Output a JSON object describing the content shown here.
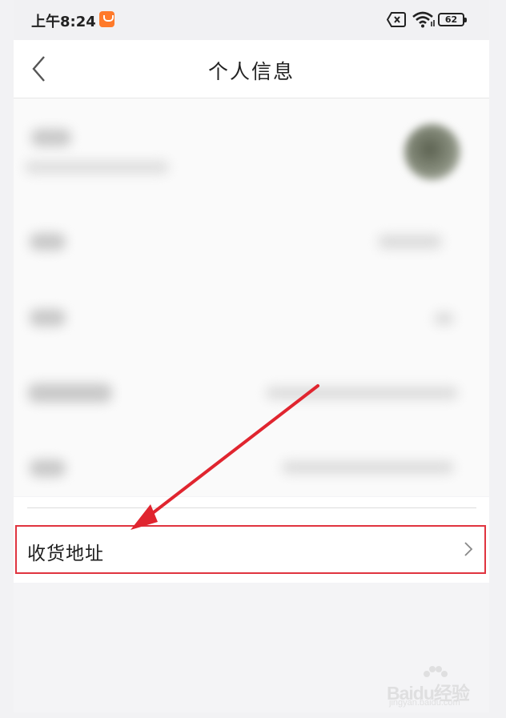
{
  "status_bar": {
    "time": "上午8:24",
    "battery_level": "62",
    "icons": [
      "notification-app-icon",
      "sim-card-x-icon",
      "wifi-icon",
      "battery-icon"
    ]
  },
  "nav_bar": {
    "title": "个人信息",
    "back_icon": "chevron-left-icon"
  },
  "info_list": {
    "note": "",
    "rows": [
      "avatar",
      "row-2",
      "row-3",
      "row-4",
      "row-5"
    ]
  },
  "address_row": {
    "label": "收货地址",
    "chevron_icon": "chevron-right-icon",
    "highlight_color": "#e0343f"
  },
  "annotation": {
    "type": "arrow",
    "color": "#e0252f"
  },
  "watermark": {
    "main": "Baidu经验",
    "sub": "jingyan.baidu.com"
  },
  "colors": {
    "background": "#f4f4f6",
    "panel": "#ffffff",
    "text": "#222222"
  }
}
